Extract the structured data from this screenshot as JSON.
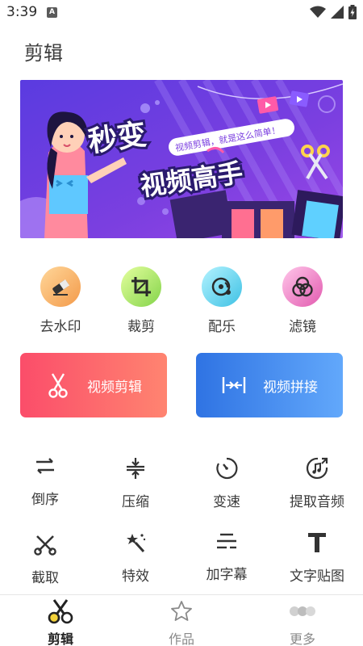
{
  "status_bar": {
    "time": "3:39",
    "indicator_letter": "A",
    "icons": [
      "wifi-icon",
      "signal-icon",
      "battery-charging-icon"
    ]
  },
  "header": {
    "title": "剪辑"
  },
  "banner": {
    "headline_1": "秒变",
    "headline_2": "视频高手",
    "tagline": "视频剪辑，就是这么简单！"
  },
  "quick_tools": [
    {
      "label": "去水印",
      "icon": "eraser-icon",
      "color": "#f7b267"
    },
    {
      "label": "裁剪",
      "icon": "crop-icon",
      "color": "#a6e36a"
    },
    {
      "label": "配乐",
      "icon": "music-disc-icon",
      "color": "#5ed1e8"
    },
    {
      "label": "滤镜",
      "icon": "filter-icon",
      "color": "#f07fc0"
    }
  ],
  "main_actions": {
    "edit": {
      "label": "视频剪辑",
      "icon": "scissors-icon",
      "color_from": "#fb4d6a",
      "color_to": "#ff8470"
    },
    "merge": {
      "label": "视频拼接",
      "icon": "merge-icon",
      "color_from": "#2f73e3",
      "color_to": "#62a8fb"
    }
  },
  "tools": [
    {
      "label": "倒序",
      "icon": "reverse-icon"
    },
    {
      "label": "压缩",
      "icon": "compress-icon"
    },
    {
      "label": "变速",
      "icon": "speed-icon"
    },
    {
      "label": "提取音频",
      "icon": "extract-audio-icon"
    },
    {
      "label": "截取",
      "icon": "cut-icon"
    },
    {
      "label": "特效",
      "icon": "magic-wand-icon"
    },
    {
      "label": "加字幕",
      "icon": "subtitle-icon"
    },
    {
      "label": "文字贴图",
      "icon": "text-icon"
    }
  ],
  "bottom_nav": [
    {
      "label": "剪辑",
      "icon": "scissors-icon",
      "active": true
    },
    {
      "label": "作品",
      "icon": "star-icon",
      "active": false
    },
    {
      "label": "更多",
      "icon": "more-icon",
      "active": false
    }
  ],
  "colors": {
    "accent": "#222222",
    "inactive": "#8a8a8a",
    "banner_bg": "#7b3fe0"
  }
}
